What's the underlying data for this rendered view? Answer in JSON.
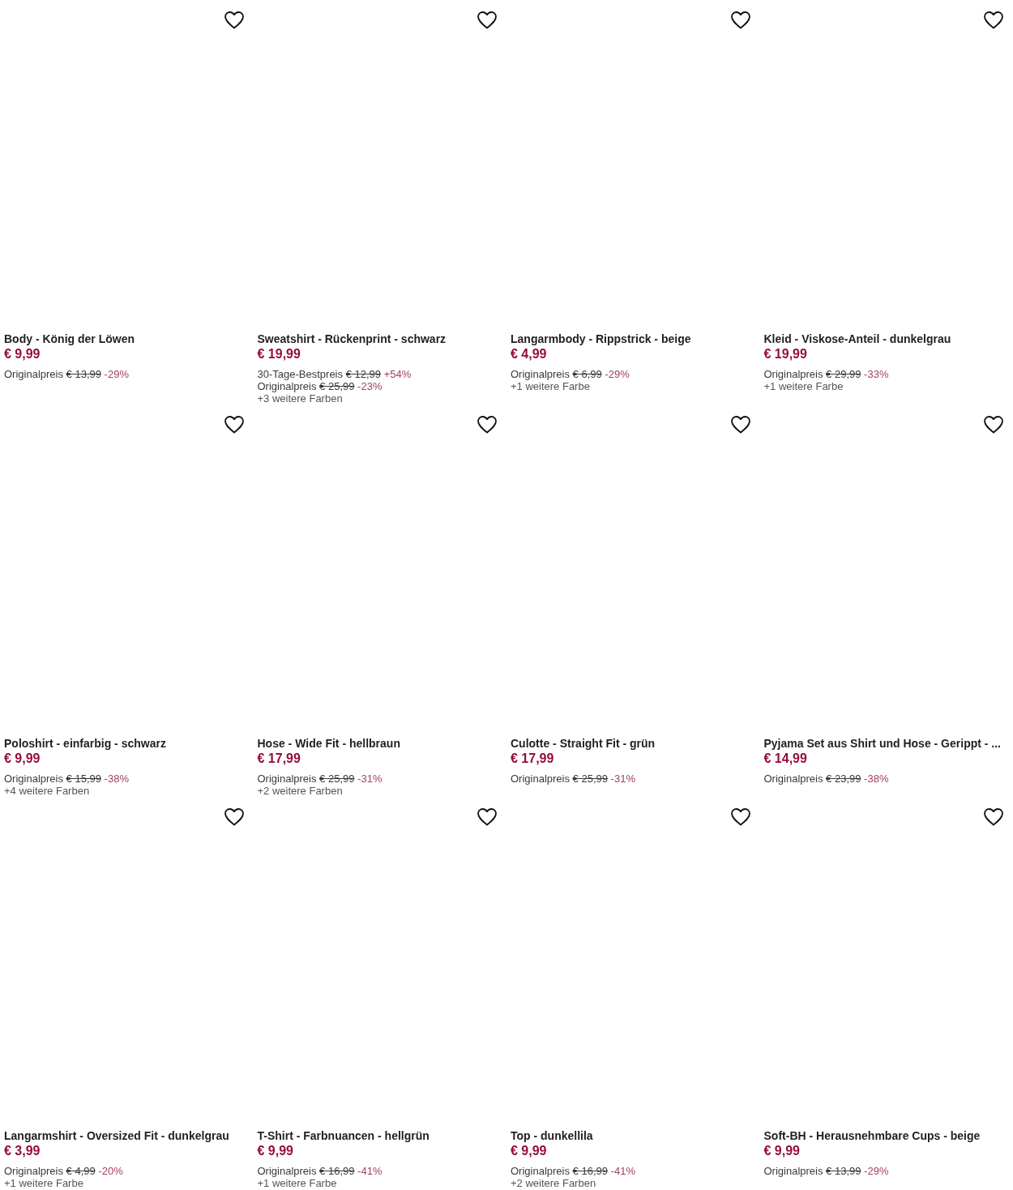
{
  "products": [
    {
      "title": "Body - König der Löwen",
      "price": "€ 9,99",
      "wishlisted": false,
      "price_lines": [
        {
          "label": "Originalpreis",
          "old_price": "€ 13,99",
          "change": "-29%"
        }
      ]
    },
    {
      "title": "Sweatshirt - Rückenprint - schwarz",
      "price": "€ 19,99",
      "wishlisted": false,
      "price_lines": [
        {
          "label": "30-Tage-Bestpreis",
          "old_price": "€ 12,99",
          "change": "+54%"
        },
        {
          "label": "Originalpreis",
          "old_price": "€ 25,99",
          "change": "-23%"
        }
      ],
      "more_colors": "+3 weitere Farben"
    },
    {
      "title": "Langarmbody - Rippstrick - beige",
      "price": "€ 4,99",
      "wishlisted": false,
      "price_lines": [
        {
          "label": "Originalpreis",
          "old_price": "€ 6,99",
          "change": "-29%"
        }
      ],
      "more_colors": "+1 weitere Farbe"
    },
    {
      "title": "Kleid - Viskose-Anteil - dunkelgrau",
      "price": "€ 19,99",
      "wishlisted": false,
      "price_lines": [
        {
          "label": "Originalpreis",
          "old_price": "€ 29,99",
          "change": "-33%"
        }
      ],
      "more_colors": "+1 weitere Farbe"
    },
    {
      "title": "Poloshirt - einfarbig - schwarz",
      "price": "€ 9,99",
      "wishlisted": false,
      "price_lines": [
        {
          "label": "Originalpreis",
          "old_price": "€ 15,99",
          "change": "-38%"
        }
      ],
      "more_colors": "+4 weitere Farben"
    },
    {
      "title": "Hose - Wide Fit - hellbraun",
      "price": "€ 17,99",
      "wishlisted": false,
      "price_lines": [
        {
          "label": "Originalpreis",
          "old_price": "€ 25,99",
          "change": "-31%"
        }
      ],
      "more_colors": "+2 weitere Farben"
    },
    {
      "title": "Culotte - Straight Fit - grün",
      "price": "€ 17,99",
      "wishlisted": false,
      "price_lines": [
        {
          "label": "Originalpreis",
          "old_price": "€ 25,99",
          "change": "-31%"
        }
      ]
    },
    {
      "title": "Pyjama Set aus Shirt und Hose - Gerippt - ...",
      "price": "€ 14,99",
      "wishlisted": false,
      "price_lines": [
        {
          "label": "Originalpreis",
          "old_price": "€ 23,99",
          "change": "-38%"
        }
      ]
    },
    {
      "title": "Langarmshirt - Oversized Fit - dunkelgrau",
      "price": "€ 3,99",
      "wishlisted": false,
      "price_lines": [
        {
          "label": "Originalpreis",
          "old_price": "€ 4,99",
          "change": "-20%"
        }
      ],
      "more_colors": "+1 weitere Farbe"
    },
    {
      "title": "T-Shirt - Farbnuancen - hellgrün",
      "price": "€ 9,99",
      "wishlisted": false,
      "price_lines": [
        {
          "label": "Originalpreis",
          "old_price": "€ 16,99",
          "change": "-41%"
        }
      ],
      "more_colors": "+1 weitere Farbe"
    },
    {
      "title": "Top - dunkellila",
      "price": "€ 9,99",
      "wishlisted": false,
      "price_lines": [
        {
          "label": "Originalpreis",
          "old_price": "€ 16,99",
          "change": "-41%"
        }
      ],
      "more_colors": "+2 weitere Farben"
    },
    {
      "title": "Soft-BH - Herausnehmbare Cups - beige",
      "price": "€ 9,99",
      "wishlisted": false,
      "price_lines": [
        {
          "label": "Originalpreis",
          "old_price": "€ 13,99",
          "change": "-29%"
        }
      ]
    }
  ]
}
